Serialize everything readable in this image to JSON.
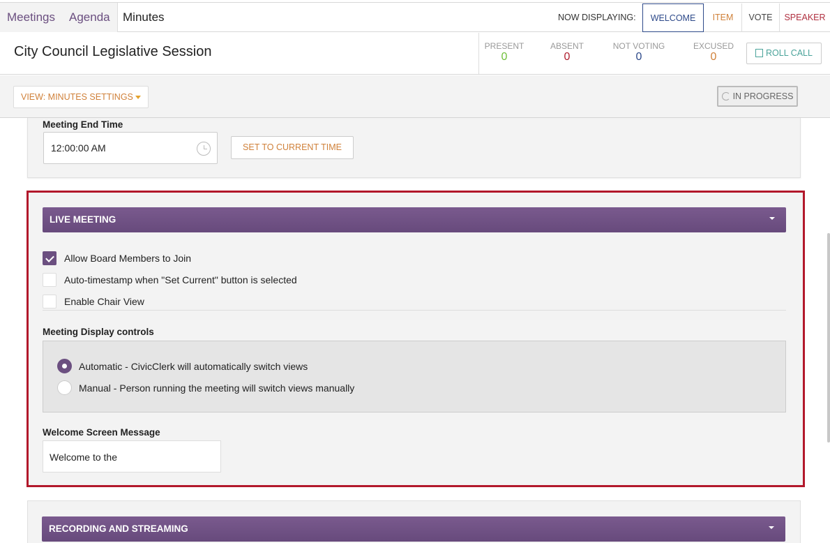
{
  "nav": {
    "tabs": [
      "Meetings",
      "Agenda",
      "Minutes"
    ],
    "now_displaying_label": "NOW DISPLAYING:",
    "display_options": [
      "WELCOME",
      "ITEM",
      "VOTE",
      "SPEAKER"
    ],
    "selected_display": "WELCOME"
  },
  "header": {
    "title": "City Council Legislative Session",
    "stats": {
      "present_label": "PRESENT",
      "present_value": "0",
      "absent_label": "ABSENT",
      "absent_value": "0",
      "not_voting_label": "NOT VOTING",
      "not_voting_value": "0",
      "excused_label": "EXCUSED",
      "excused_value": "0"
    },
    "roll_call_label": "ROLL CALL"
  },
  "toolbar": {
    "view_select": "VIEW: MINUTES SETTINGS",
    "status": "IN PROGRESS"
  },
  "meeting_end": {
    "label": "Meeting End Time",
    "value": "12:00:00 AM",
    "set_current_label": "SET TO CURRENT TIME"
  },
  "live_meeting": {
    "title": "LIVE MEETING",
    "checkboxes": [
      {
        "label": "Allow Board Members to Join",
        "checked": true
      },
      {
        "label": "Auto-timestamp when \"Set Current\" button is selected",
        "checked": false
      },
      {
        "label": "Enable Chair View",
        "checked": false
      }
    ],
    "display_controls_label": "Meeting Display controls",
    "radios": [
      {
        "label": "Automatic - CivicClerk will automatically switch views",
        "selected": true
      },
      {
        "label": "Manual - Person running the meeting will switch views manually",
        "selected": false
      }
    ],
    "welcome_label": "Welcome Screen Message",
    "welcome_value": "Welcome to the"
  },
  "recording": {
    "title": "RECORDING AND STREAMING"
  },
  "colors": {
    "purple": "#6b4f80",
    "orange": "#d0813a",
    "highlight_border": "#b2182b",
    "present": "#6fbf3a",
    "absent": "#b02030",
    "not_voting": "#2e4a8a"
  }
}
